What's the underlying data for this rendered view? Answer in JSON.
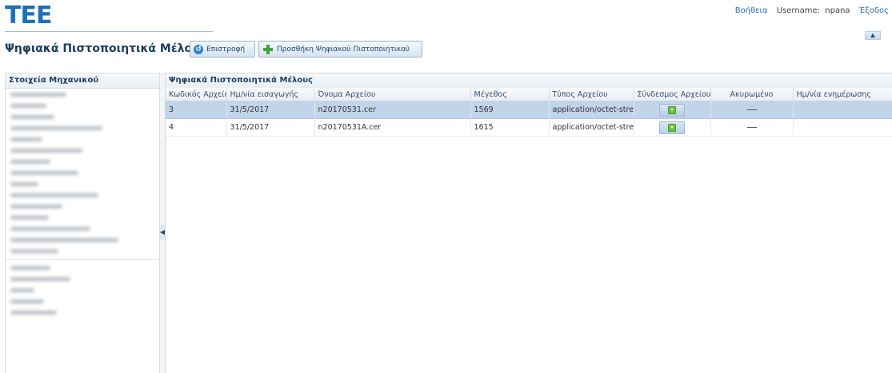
{
  "header": {
    "logo": "ΤΕΕ",
    "help_link": "Βοήθεια",
    "username_label": "Username:",
    "username_value": "npana",
    "logout_link": "Έξοδος",
    "collapse_symbol": "▲"
  },
  "toolbar": {
    "title": "Ψηφιακά Πιστοποιητικά Μέλους",
    "back_label": "Επιστροφή",
    "add_label": "Προσθήκη Ψηφιακού Πιστοποιητικού"
  },
  "left_panel": {
    "title": "Στοιχεία Μηχανικού"
  },
  "grid": {
    "title": "Ψηφιακά Πιστοποιητικά Μέλους",
    "columns": [
      "Κωδικός Αρχείου",
      "Ημ/νία εισαγωγής",
      "Όνομα Αρχείου",
      "Μέγεθος",
      "Τύπος Αρχείου",
      "Σύνδεσμος Αρχείου",
      "Ακυρωμένο",
      "Ημ/νία ενημέρωσης"
    ],
    "rows": [
      {
        "code": "3",
        "date": "31/5/2017",
        "filename": "n20170531.cer",
        "size": "1569",
        "type": "application/octet-stre",
        "updated": ""
      },
      {
        "code": "4",
        "date": "31/5/2017",
        "filename": "n20170531A.cer",
        "size": "1615",
        "type": "application/octet-stre",
        "updated": ""
      }
    ]
  },
  "icons": {
    "back": "back-circle-icon",
    "add": "plus-icon",
    "download": "download-icon",
    "splitter": "collapse-left-arrow-icon"
  },
  "colors": {
    "brand_blue": "#1e6fb5",
    "title_navy": "#1c3d62",
    "selected_row": "#c2d4e9"
  }
}
